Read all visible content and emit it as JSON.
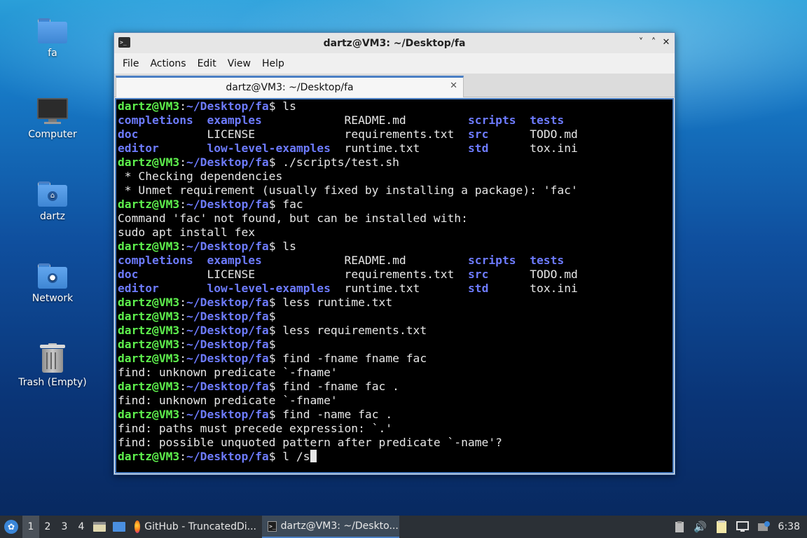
{
  "desktop": {
    "icons": [
      {
        "label": "fa"
      },
      {
        "label": "Computer"
      },
      {
        "label": "dartz"
      },
      {
        "label": "Network"
      },
      {
        "label": "Trash (Empty)"
      }
    ]
  },
  "window": {
    "title": "dartz@VM3: ~/Desktop/fa",
    "controls": {
      "minimize": "˅",
      "maximize": "˄",
      "close": "✕"
    },
    "menu": [
      "File",
      "Actions",
      "Edit",
      "View",
      "Help"
    ],
    "tab_label": "dartz@VM3: ~/Desktop/fa",
    "tab_close": "✕"
  },
  "terminal": {
    "lines": [
      {
        "type": "prompt",
        "user": "dartz@VM3",
        "path": "~/Desktop/fa",
        "cmd": " ls"
      },
      {
        "type": "ls",
        "cols": [
          [
            "completions",
            true
          ],
          [
            "examples",
            true
          ],
          [
            "README.md",
            false
          ],
          [
            "scripts",
            true
          ],
          [
            "tests",
            true
          ]
        ]
      },
      {
        "type": "ls",
        "cols": [
          [
            "doc",
            true
          ],
          [
            "LICENSE",
            false
          ],
          [
            "requirements.txt",
            false
          ],
          [
            "src",
            true
          ],
          [
            "TODO.md",
            false
          ]
        ]
      },
      {
        "type": "ls",
        "cols": [
          [
            "editor",
            true
          ],
          [
            "low-level-examples",
            true
          ],
          [
            "runtime.txt",
            false
          ],
          [
            "std",
            true
          ],
          [
            "tox.ini",
            false
          ]
        ]
      },
      {
        "type": "prompt",
        "user": "dartz@VM3",
        "path": "~/Desktop/fa",
        "cmd": " ./scripts/test.sh"
      },
      {
        "type": "text",
        "text": " * Checking dependencies"
      },
      {
        "type": "text",
        "text": " * Unmet requirement (usually fixed by installing a package): 'fac'"
      },
      {
        "type": "prompt",
        "user": "dartz@VM3",
        "path": "~/Desktop/fa",
        "cmd": " fac"
      },
      {
        "type": "text",
        "text": "Command 'fac' not found, but can be installed with:"
      },
      {
        "type": "text",
        "text": "sudo apt install fex"
      },
      {
        "type": "prompt",
        "user": "dartz@VM3",
        "path": "~/Desktop/fa",
        "cmd": " ls"
      },
      {
        "type": "ls",
        "cols": [
          [
            "completions",
            true
          ],
          [
            "examples",
            true
          ],
          [
            "README.md",
            false
          ],
          [
            "scripts",
            true
          ],
          [
            "tests",
            true
          ]
        ]
      },
      {
        "type": "ls",
        "cols": [
          [
            "doc",
            true
          ],
          [
            "LICENSE",
            false
          ],
          [
            "requirements.txt",
            false
          ],
          [
            "src",
            true
          ],
          [
            "TODO.md",
            false
          ]
        ]
      },
      {
        "type": "ls",
        "cols": [
          [
            "editor",
            true
          ],
          [
            "low-level-examples",
            true
          ],
          [
            "runtime.txt",
            false
          ],
          [
            "std",
            true
          ],
          [
            "tox.ini",
            false
          ]
        ]
      },
      {
        "type": "prompt",
        "user": "dartz@VM3",
        "path": "~/Desktop/fa",
        "cmd": " less runtime.txt"
      },
      {
        "type": "prompt",
        "user": "dartz@VM3",
        "path": "~/Desktop/fa",
        "cmd": ""
      },
      {
        "type": "prompt",
        "user": "dartz@VM3",
        "path": "~/Desktop/fa",
        "cmd": " less requirements.txt"
      },
      {
        "type": "prompt",
        "user": "dartz@VM3",
        "path": "~/Desktop/fa",
        "cmd": ""
      },
      {
        "type": "prompt",
        "user": "dartz@VM3",
        "path": "~/Desktop/fa",
        "cmd": " find -fname fname fac"
      },
      {
        "type": "text",
        "text": "find: unknown predicate `-fname'"
      },
      {
        "type": "prompt",
        "user": "dartz@VM3",
        "path": "~/Desktop/fa",
        "cmd": " find -fname fac ."
      },
      {
        "type": "text",
        "text": "find: unknown predicate `-fname'"
      },
      {
        "type": "prompt",
        "user": "dartz@VM3",
        "path": "~/Desktop/fa",
        "cmd": " find -name fac ."
      },
      {
        "type": "text",
        "text": "find: paths must precede expression: `.'"
      },
      {
        "type": "text",
        "text": "find: possible unquoted pattern after predicate `-name'?"
      },
      {
        "type": "prompt",
        "user": "dartz@VM3",
        "path": "~/Desktop/fa",
        "cmd": " l /s",
        "cursor": true
      }
    ]
  },
  "taskbar": {
    "workspaces": [
      "1",
      "2",
      "3",
      "4"
    ],
    "active_workspace": "1",
    "tasks": [
      {
        "label": "GitHub - TruncatedDi...",
        "icon": "firefox-icon"
      },
      {
        "label": "dartz@VM3: ~/Deskto...",
        "icon": "terminal-icon",
        "active": true
      }
    ],
    "clock": "6:38"
  }
}
